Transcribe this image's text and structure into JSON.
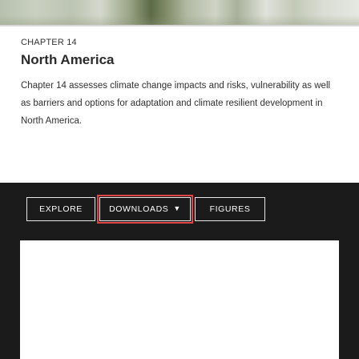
{
  "chapter": {
    "eyebrow": "CHAPTER 14",
    "title": "North America",
    "description": "Chapter 14 assesses climate change impacts and risks, vulnerability as well as barriers and options for adaptation and climate resilient development in North America."
  },
  "buttons": {
    "explore": "EXPLORE",
    "downloads": "DOWNLOADS",
    "downloads_icon": "chevron-down-icon",
    "figures": "FIGURES"
  },
  "colors": {
    "panel": "#1b1b1b",
    "card": "#ffffff",
    "focus_outline": "#e04444"
  }
}
